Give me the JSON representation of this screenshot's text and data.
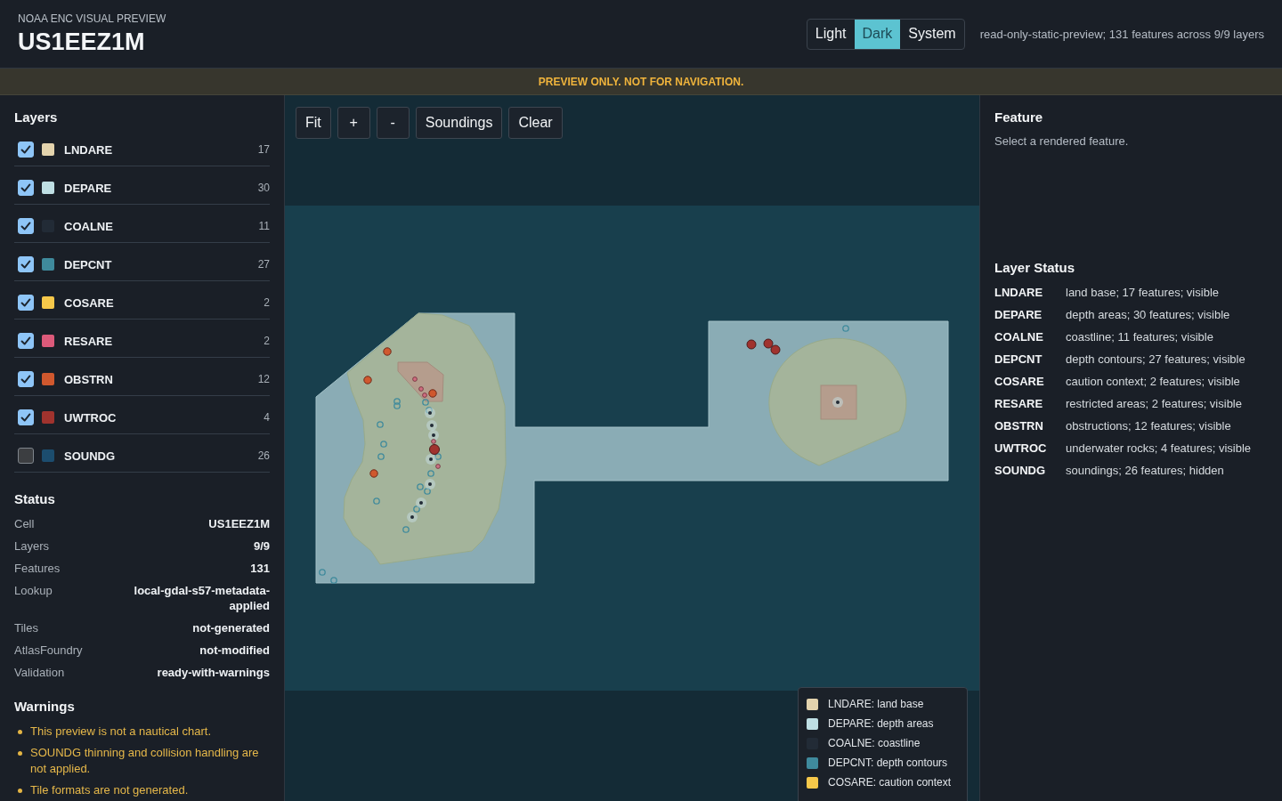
{
  "header": {
    "eyebrow": "NOAA ENC VISUAL PREVIEW",
    "title": "US1EEZ1M",
    "themes": [
      {
        "label": "Light",
        "selected": false
      },
      {
        "label": "Dark",
        "selected": true
      },
      {
        "label": "System",
        "selected": false
      }
    ],
    "summary": "read-only-static-preview; 131 features across 9/9 layers"
  },
  "banner": "PREVIEW ONLY. NOT FOR NAVIGATION.",
  "layers_panel": {
    "title": "Layers",
    "layers": [
      {
        "name": "LNDARE",
        "count": "17",
        "checked": true,
        "color": "#e3d3ad"
      },
      {
        "name": "DEPARE",
        "count": "30",
        "checked": true,
        "color": "#bfdfe4"
      },
      {
        "name": "COALNE",
        "count": "11",
        "checked": true,
        "color": "#222b36"
      },
      {
        "name": "DEPCNT",
        "count": "27",
        "checked": true,
        "color": "#3f8a9c"
      },
      {
        "name": "COSARE",
        "count": "2",
        "checked": true,
        "color": "#f6c84a"
      },
      {
        "name": "RESARE",
        "count": "2",
        "checked": true,
        "color": "#dc5a7a"
      },
      {
        "name": "OBSTRN",
        "count": "12",
        "checked": true,
        "color": "#d0582e"
      },
      {
        "name": "UWTROC",
        "count": "4",
        "checked": true,
        "color": "#a0332e"
      },
      {
        "name": "SOUNDG",
        "count": "26",
        "checked": false,
        "color": "#1c4d6e"
      }
    ]
  },
  "status_panel": {
    "title": "Status",
    "rows": [
      {
        "label": "Cell",
        "value": "US1EEZ1M"
      },
      {
        "label": "Layers",
        "value": "9/9"
      },
      {
        "label": "Features",
        "value": "131"
      },
      {
        "label": "Lookup",
        "value": "local-gdal-s57-metadata-applied"
      },
      {
        "label": "Tiles",
        "value": "not-generated"
      },
      {
        "label": "AtlasFoundry",
        "value": "not-modified"
      },
      {
        "label": "Validation",
        "value": "ready-with-warnings"
      }
    ]
  },
  "warnings": {
    "title": "Warnings",
    "items": [
      "This preview is not a nautical chart.",
      "SOUNDG thinning and collision handling are not applied.",
      "Tile formats are not generated."
    ]
  },
  "toolbar": {
    "buttons": [
      "Fit",
      "+",
      "-",
      "Soundings",
      "Clear"
    ]
  },
  "legend": {
    "items": [
      {
        "label": "LNDARE: land base",
        "color": "#e3d3ad"
      },
      {
        "label": "DEPARE: depth areas",
        "color": "#bfdfe4"
      },
      {
        "label": "COALNE: coastline",
        "color": "#222b36"
      },
      {
        "label": "DEPCNT: depth contours",
        "color": "#3f8a9c"
      },
      {
        "label": "COSARE: caution context",
        "color": "#f6c84a"
      }
    ]
  },
  "feature_panel": {
    "title": "Feature",
    "hint": "Select a rendered feature."
  },
  "layer_status": {
    "title": "Layer Status",
    "rows": [
      {
        "code": "LNDARE",
        "text": "land base; 17 features; visible"
      },
      {
        "code": "DEPARE",
        "text": "depth areas; 30 features; visible"
      },
      {
        "code": "COALNE",
        "text": "coastline; 11 features; visible"
      },
      {
        "code": "DEPCNT",
        "text": "depth contours; 27 features; visible"
      },
      {
        "code": "COSARE",
        "text": "caution context; 2 features; visible"
      },
      {
        "code": "RESARE",
        "text": "restricted areas; 2 features; visible"
      },
      {
        "code": "OBSTRN",
        "text": "obstructions; 12 features; visible"
      },
      {
        "code": "UWTROC",
        "text": "underwater rocks; 4 features; visible"
      },
      {
        "code": "SOUNDG",
        "text": "soundings; 26 features; hidden"
      }
    ]
  }
}
